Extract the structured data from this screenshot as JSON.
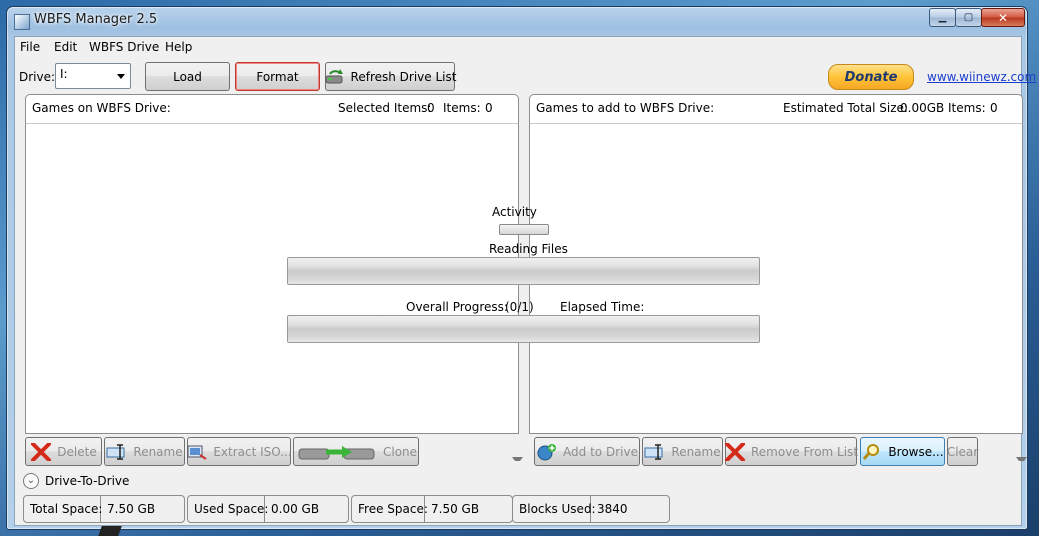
{
  "window": {
    "title": "WBFS Manager 2.5"
  },
  "menu": [
    "File",
    "Edit",
    "WBFS Drive",
    "Help"
  ],
  "toolbar": {
    "drive_label": "Drive:",
    "drive_value": "I:",
    "load": "Load",
    "format": "Format",
    "refresh": "Refresh Drive List",
    "donate": "Donate",
    "link": "www.wiinewz.com"
  },
  "left_panel": {
    "title": "Games on WBFS Drive:",
    "selected_label": "Selected Items:",
    "selected_value": "0",
    "items_label": "Items:",
    "items_value": "0",
    "buttons": {
      "delete": "Delete",
      "rename": "Rename",
      "extract": "Extract ISO...",
      "clone": "Clone"
    }
  },
  "right_panel": {
    "title": "Games to add to WBFS Drive:",
    "size_label": "Estimated Total Size:",
    "size_value": "0.00GB",
    "items_label": "Items:",
    "items_value": "0",
    "buttons": {
      "add": "Add to Drive",
      "rename": "Rename",
      "remove": "Remove From List",
      "browse": "Browse...",
      "clear": "Clear"
    }
  },
  "progress": {
    "activity_label": "Activity",
    "reading_label": "Reading Files",
    "reading_fraction": 0,
    "overall_label": "Overall Progress:",
    "overall_value": "(0/1)",
    "overall_fraction": 0,
    "elapsed_label": "Elapsed Time:"
  },
  "drive_to_drive": {
    "label": "Drive-To-Drive"
  },
  "status": {
    "total_label": "Total Space:",
    "total_value": "7.50 GB",
    "used_label": "Used Space:",
    "used_value": "0.00 GB",
    "free_label": "Free Space:",
    "free_value": "7.50 GB",
    "blocks_label": "Blocks Used:",
    "blocks_value": "3840"
  },
  "colors": {
    "accent": "#3c7fb1",
    "delete_red": "#d42a1a",
    "focus_red": "#c0392b",
    "link": "#1a3fcf"
  }
}
